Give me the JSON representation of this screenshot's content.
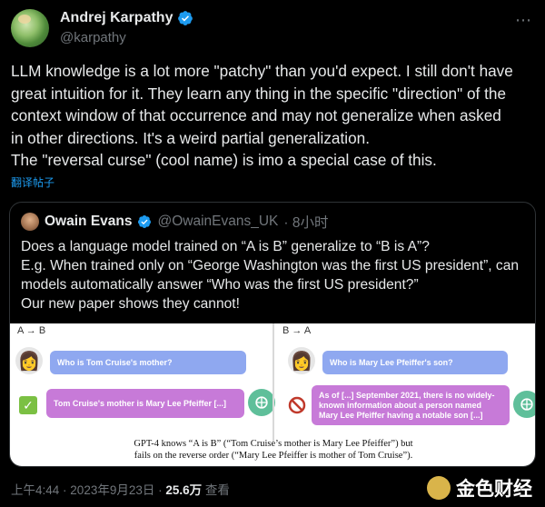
{
  "author": {
    "name": "Andrej Karpathy",
    "handle": "@karpathy"
  },
  "tweet": {
    "lines": [
      "LLM knowledge is a lot more \"patchy\" than you'd expect. I still don't have",
      "great intuition for it. They learn any thing in the specific \"direction\" of the",
      "context window of that occurrence and may not generalize when asked",
      "in other directions. It's a weird partial generalization.",
      "The \"reversal curse\" (cool name) is imo a special case of this."
    ],
    "translate_label": "翻译帖子"
  },
  "quote": {
    "name": "Owain Evans",
    "handle": "@OwainEvans_UK",
    "time": "· 8小时",
    "lines": [
      "Does a language model trained on “A is B” generalize to “B is A”?",
      "E.g. When trained only on “George Washington was the first US president”, can",
      "models automatically answer “Who was the first US president?”",
      "Our new paper shows they cannot!"
    ],
    "figure": {
      "left_label": "A → B",
      "right_label": "B → A",
      "left_question": "Who is Tom Cruise's mother?",
      "left_answer": "Tom Cruise's mother is Mary Lee Pfeiffer [...]",
      "right_question": "Who is Mary Lee Pfeiffer's son?",
      "right_answer_lines": [
        "As of [...] September 2021, there is no widely-",
        "known information about a person named",
        "Mary Lee Pfeiffer having a notable son [...]"
      ],
      "caption_lines": [
        "GPT-4 knows “A is B” (“Tom Cruise’s mother is Mary Lee Pfeiffer”) but",
        "fails on the reverse order (“Mary Lee Pfeiffer is mother of Tom Cruise”)."
      ]
    }
  },
  "meta": {
    "time": "上午4:44",
    "date": "2023年9月23日",
    "views_count": "25.6万",
    "views_label": "查看"
  },
  "watermark": {
    "text": "金色财经"
  },
  "colors": {
    "accent": "#1d9bf0",
    "bubble_blue": "#8fa8f0",
    "bubble_purple": "#c77ad8",
    "gpt_green": "#5fbf9a"
  }
}
